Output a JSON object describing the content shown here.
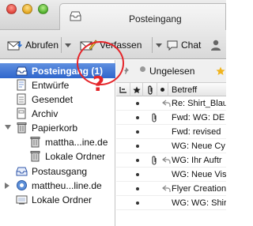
{
  "window": {
    "tab_title": "Posteingang"
  },
  "toolbar": {
    "get_label": "Abrufen",
    "compose_label": "Verfassen",
    "chat_label": "Chat"
  },
  "sidebar": {
    "items": [
      {
        "label": "Posteingang (1)",
        "icon": "inbox-icon",
        "selected": true
      },
      {
        "label": "Entwürfe",
        "icon": "drafts-icon"
      },
      {
        "label": "Gesendet",
        "icon": "sent-icon"
      },
      {
        "label": "Archiv",
        "icon": "archive-icon"
      },
      {
        "label": "Papierkorb",
        "icon": "trash-icon",
        "expanded": true
      },
      {
        "label": "mattha...ine.de",
        "icon": "trash-can-icon"
      },
      {
        "label": "Lokale Ordner",
        "icon": "trash-can-icon"
      },
      {
        "label": "Postausgang",
        "icon": "outbox-icon"
      },
      {
        "label": "mattheu...line.de",
        "icon": "account-icon"
      },
      {
        "label": "Lokale Ordner",
        "icon": "local-folders-icon"
      }
    ]
  },
  "filter": {
    "unread_label": "Ungelesen"
  },
  "columns": {
    "subject_label": "Betreff"
  },
  "messages": [
    {
      "subject": "Re: Shirt_Blau",
      "attachment": false,
      "replied": true
    },
    {
      "subject": "Fwd: WG: DE",
      "attachment": true,
      "replied": false
    },
    {
      "subject": "Fwd: revised",
      "attachment": false,
      "replied": false
    },
    {
      "subject": "WG: Neue Cy",
      "attachment": false,
      "replied": false
    },
    {
      "subject": "WG: Ihr Auftr",
      "attachment": true,
      "replied": true
    },
    {
      "subject": "WG: Neue Vis",
      "attachment": false,
      "replied": false
    },
    {
      "subject": "Flyer Creation",
      "attachment": false,
      "replied": true
    },
    {
      "subject": "WG: WG: Shir",
      "attachment": false,
      "replied": false
    }
  ],
  "annotation": {
    "symbol": "?",
    "color": "#e5252a"
  },
  "colors": {
    "selection": "#2f66cc",
    "annotation": "#e5252a"
  }
}
